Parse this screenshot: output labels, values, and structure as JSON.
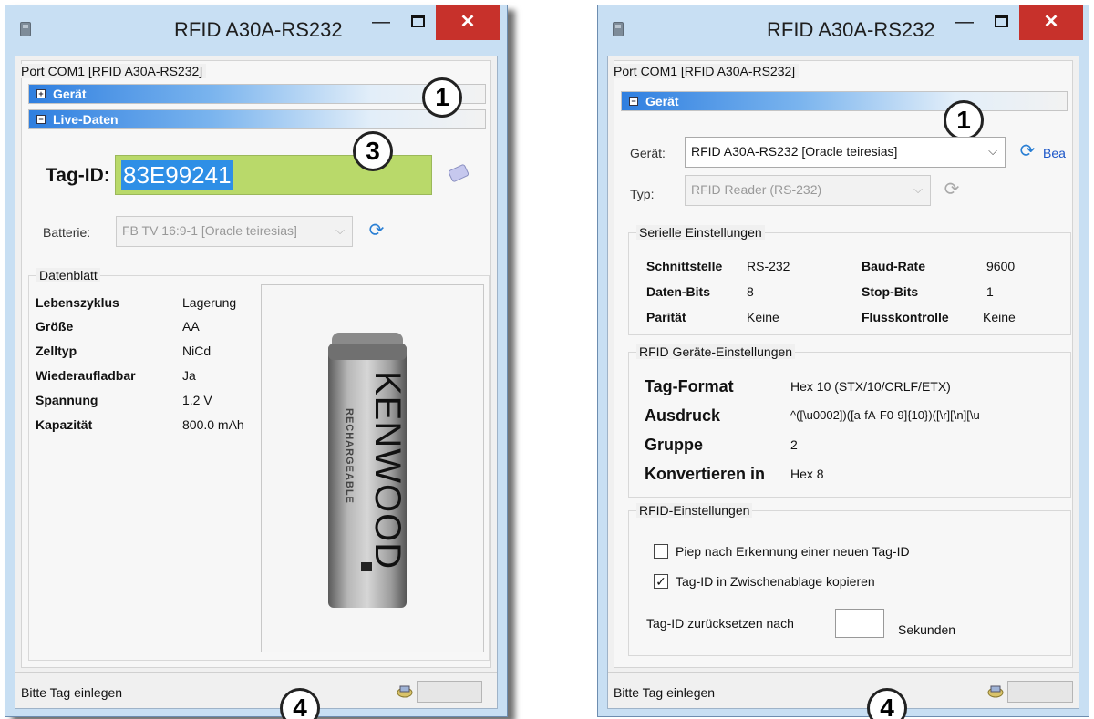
{
  "left": {
    "title": "RFID A30A-RS232",
    "port_label": "Port COM1  [RFID A30A-RS232]",
    "section_geraet": "Gerät",
    "section_live": "Live-Daten",
    "pm_collapsed": "+",
    "pm_expanded": "−",
    "callout_1": "1",
    "callout_3": "3",
    "callout_4": "4",
    "tag_id_label": "Tag-ID:",
    "tag_id_value": "83E99241",
    "batterie_label": "Batterie:",
    "batterie_value": "FB TV 16:9-1 [Oracle teiresias]",
    "datenblatt_label": "Datenblatt",
    "datenblatt": [
      {
        "key": "Lebenszyklus",
        "value": "Lagerung"
      },
      {
        "key": "Größe",
        "value": "AA"
      },
      {
        "key": "Zelltyp",
        "value": "NiCd"
      },
      {
        "key": "Wiederaufladbar",
        "value": "Ja"
      },
      {
        "key": "Spannung",
        "value": "1.2 V"
      },
      {
        "key": "Kapazität",
        "value": "800.0 mAh"
      }
    ],
    "battery_brand": "KENWOOD",
    "battery_sub": "RECHARGEABLE",
    "status_text": "Bitte Tag einlegen"
  },
  "right": {
    "title": "RFID A30A-RS232",
    "port_label": "Port COM1  [RFID A30A-RS232]",
    "section_geraet": "Gerät",
    "pm_expanded": "−",
    "callout_1": "1",
    "callout_4": "4",
    "geraet_label": "Gerät:",
    "geraet_value": "RFID A30A-RS232 [Oracle teiresias]",
    "geraet_link": "Bea",
    "typ_label": "Typ:",
    "typ_value": "RFID Reader (RS-232)",
    "serielle_label": "Serielle Einstellungen",
    "serial": {
      "schnittstelle_k": "Schnittstelle",
      "schnittstelle_v": "RS-232",
      "baud_k": "Baud-Rate",
      "baud_v": "9600",
      "datenbits_k": "Daten-Bits",
      "datenbits_v": "8",
      "stopbits_k": "Stop-Bits",
      "stopbits_v": "1",
      "paritaet_k": "Parität",
      "paritaet_v": "Keine",
      "fluss_k": "Flusskontrolle",
      "fluss_v": "Keine"
    },
    "rfid_geraete_label": "RFID Geräte-Einstellungen",
    "rfid": {
      "tagformat_k": "Tag-Format",
      "tagformat_v": "Hex 10 (STX/10/CRLF/ETX)",
      "ausdruck_k": "Ausdruck",
      "ausdruck_v": "^([\\u0002])([a-fA-F0-9]{10})([\\r][\\n][\\u",
      "gruppe_k": "Gruppe",
      "gruppe_v": "2",
      "konv_k": "Konvertieren in",
      "konv_v": "Hex 8"
    },
    "rfid_einst_label": "RFID-Einstellungen",
    "cb_piep": "Piep nach Erkennung einer neuen Tag-ID",
    "cb_piep_checked": false,
    "cb_copy": "Tag-ID in Zwischenablage kopieren",
    "cb_copy_checked": true,
    "check_mark": "✓",
    "reset_label": "Tag-ID zurücksetzen nach",
    "reset_value": "",
    "sekunden": "Sekunden",
    "status_text": "Bitte Tag einlegen"
  },
  "colors": {
    "tag_field_bg": "#b9d96a",
    "tag_selection_bg": "#2e8fe6",
    "close_red": "#c7312b",
    "section_blue": "#2f7fe0"
  }
}
